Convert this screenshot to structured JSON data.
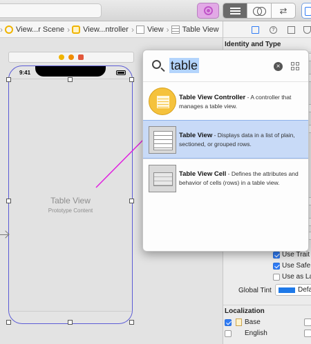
{
  "jumpbar": {
    "items": [
      "View...r Scene",
      "View...ntroller",
      "View",
      "Table View"
    ]
  },
  "canvas": {
    "status_time": "9:41",
    "table_view_title": "Table View",
    "table_view_subtitle": "Prototype Content"
  },
  "library": {
    "search_value": "table",
    "items": [
      {
        "title": "Table View Controller",
        "description": " - A controller that manages a table view.",
        "icon": "table-view-controller-icon",
        "selected": false
      },
      {
        "title": "Table View",
        "description": " - Displays data in a list of plain, sectioned, or grouped rows.",
        "icon": "table-view-icon",
        "selected": true
      },
      {
        "title": "Table View Cell",
        "description": " - Defines the attributes and behavior of cells (rows) in a table view.",
        "icon": "table-view-cell-icon",
        "selected": false
      }
    ]
  },
  "inspector": {
    "identity_title": "Identity and Type",
    "checkboxes": [
      {
        "label": "Use Trait",
        "checked": true
      },
      {
        "label": "Use Safe",
        "checked": true
      },
      {
        "label": "Use as La",
        "checked": false
      }
    ],
    "global_tint_label": "Global Tint",
    "global_tint_value": "Defau",
    "global_tint_color": "#1e79e8",
    "localization_title": "Localization",
    "localizations": [
      {
        "label": "Base",
        "checked": true
      },
      {
        "label": "English",
        "checked": false
      }
    ]
  },
  "colors": {
    "selection": "#c8daf7",
    "accent": "#2f7bf5",
    "drag_line": "#e01ee0",
    "library_button": "#e2a9e6"
  }
}
